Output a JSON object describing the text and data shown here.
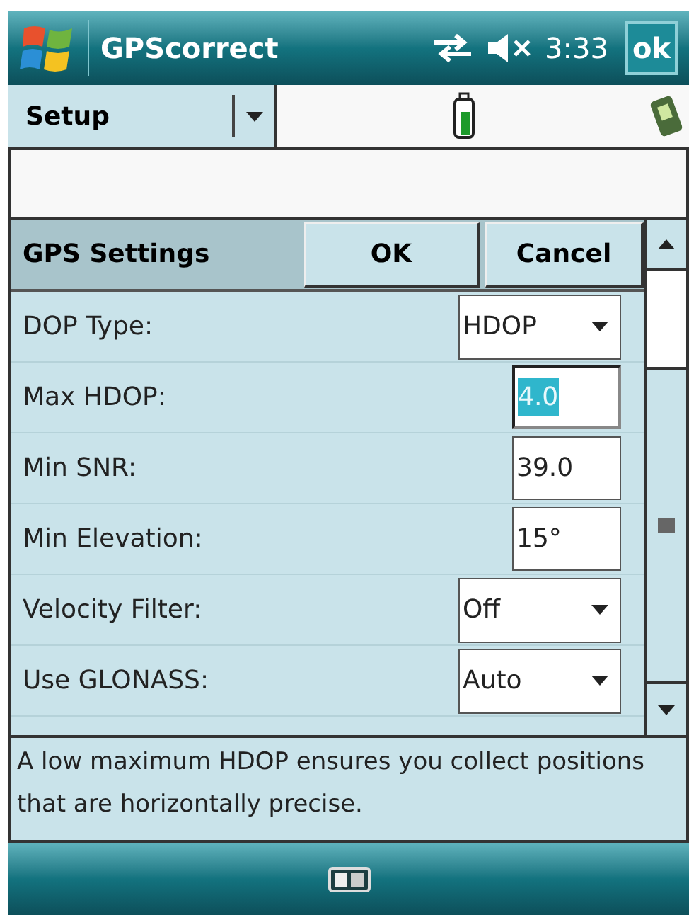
{
  "title_bar": {
    "title": "GPScorrect",
    "time": "3:33",
    "ok_button": "ok"
  },
  "menu_bar": {
    "menu": "Setup"
  },
  "header": {
    "title": "GPS Settings",
    "buttons": [
      "OK",
      "Cancel"
    ]
  },
  "settings": [
    {
      "kind": "dropdown",
      "label": "DOP Type:",
      "value": "HDOP",
      "focused": false
    },
    {
      "kind": "text",
      "label": "Max HDOP:",
      "value": "4.0",
      "focused": true
    },
    {
      "kind": "text",
      "label": "Min SNR:",
      "value": "39.0",
      "focused": false
    },
    {
      "kind": "text",
      "label": "Min Elevation:",
      "value": "15°",
      "focused": false
    },
    {
      "kind": "dropdown",
      "label": "Velocity Filter:",
      "value": "Off",
      "focused": false
    },
    {
      "kind": "dropdown",
      "label": "Use GLONASS:",
      "value": "Auto",
      "focused": false
    }
  ],
  "description": "A low maximum HDOP ensures you collect positions that are horizontally precise."
}
